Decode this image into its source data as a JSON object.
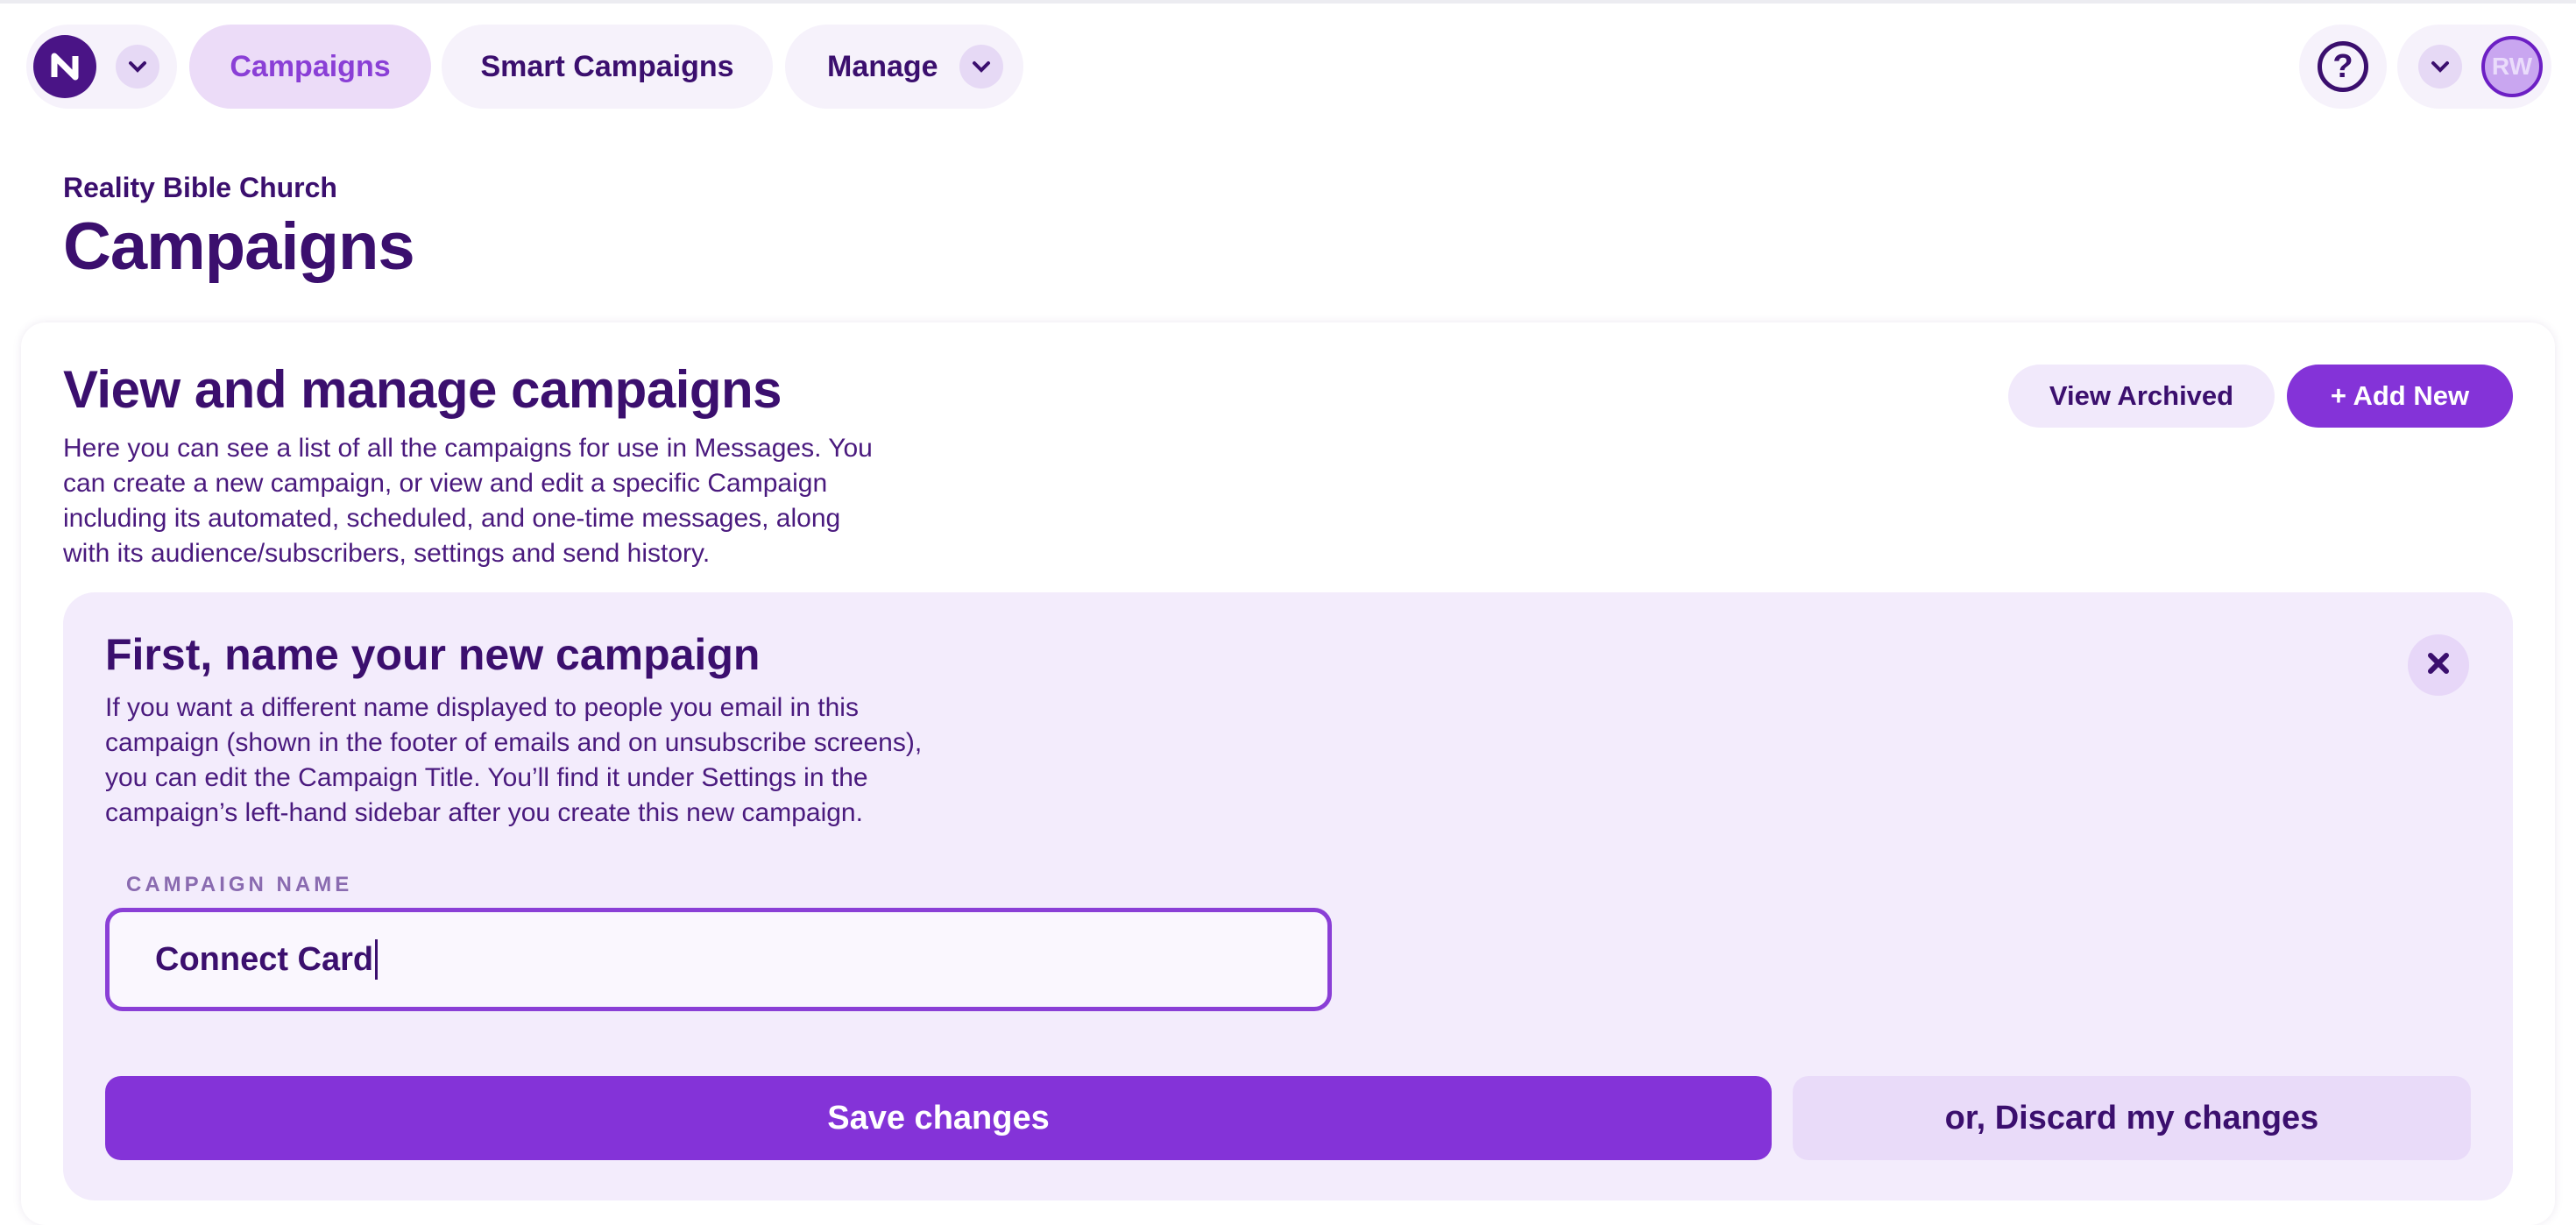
{
  "nav": {
    "tabs": {
      "campaigns": "Campaigns",
      "smart_campaigns": "Smart Campaigns",
      "manage": "Manage"
    },
    "help_glyph": "?",
    "user_initials": "RW"
  },
  "header": {
    "organization": "Reality Bible Church",
    "title": "Campaigns"
  },
  "main": {
    "title": "View and manage campaigns",
    "description": "Here you can see a list of all the campaigns for use in Messages. You can create a new campaign, or view and edit a specific Campaign including its automated, scheduled, and one-time messages, along with its audience/subscribers, settings and send history.",
    "view_archived_label": "View Archived",
    "add_new_label": "+ Add New"
  },
  "new_campaign": {
    "title": "First, name your new campaign",
    "description": "If you want a different name displayed to people you email in this campaign (shown in the footer of emails and on unsubscribe screens), you can edit the Campaign Title. You’ll find it under Settings in the campaign’s left-hand sidebar after you create this new campaign.",
    "field_label": "CAMPAIGN NAME",
    "field_value": "Connect Card",
    "save_label": "Save changes",
    "discard_label": "or, Discard my changes"
  },
  "colors": {
    "primary": "#8433d8",
    "text_dark": "#3b0f6e",
    "panel_bg": "#f3ecfc",
    "pill_bg": "#f6f2fb"
  },
  "icons": [
    "logo-n-icon",
    "chevron-down-icon",
    "help-icon",
    "close-icon"
  ]
}
